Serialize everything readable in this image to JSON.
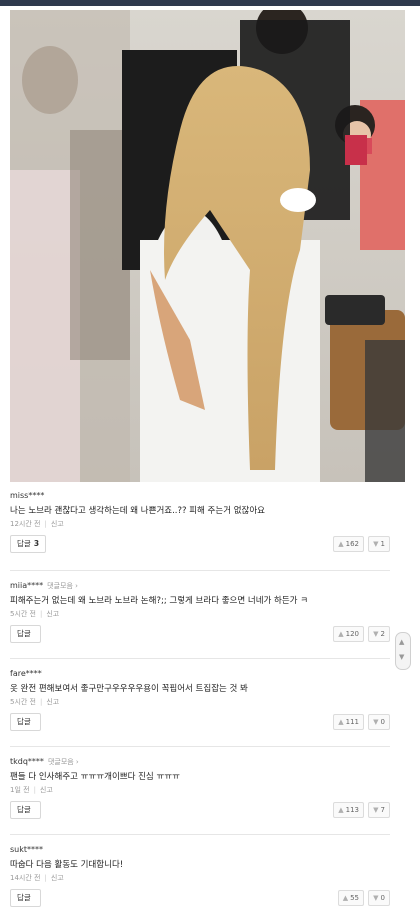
{
  "photo": {
    "alt": "airport crowd photo"
  },
  "comments": [
    {
      "user": "miss****",
      "more": "",
      "text": "나는 노브라 괜찮다고 생각하는데 왜 나쁜거죠..?? 피해 주는거 없잖아요",
      "time": "12시간 전",
      "report": "신고",
      "reply": "답글",
      "reply_count": "3",
      "up": "162",
      "down": "1"
    },
    {
      "user": "miia****",
      "more": "댓글모음 ›",
      "text": "피해주는거 없는데 왜 노브라 노브라 논해?;; 그렇게 브라다 좋으면 너네가 하든가 ㅋ",
      "time": "5시간 전",
      "report": "신고",
      "reply": "답글",
      "reply_count": "",
      "up": "120",
      "down": "2"
    },
    {
      "user": "fare****",
      "more": "",
      "text": "옷 완전 편해보여서 좋구만구우우우우용이 꼭핍어서 트집잡는 것 봐",
      "time": "5시간 전",
      "report": "신고",
      "reply": "답글",
      "reply_count": "",
      "up": "111",
      "down": "0"
    },
    {
      "user": "tkdq****",
      "more": "댓글모음 ›",
      "text": "팬들 다 인사해주고 ㅠㅠㅠ개이쁘다 진심 ㅠㅠㅠ",
      "time": "1일 전",
      "report": "신고",
      "reply": "답글",
      "reply_count": "",
      "up": "113",
      "down": "7"
    },
    {
      "user": "sukt****",
      "more": "",
      "text": "따숩다 다음 활동도 기대합니다!",
      "time": "14시간 전",
      "report": "신고",
      "reply": "답글",
      "reply_count": "",
      "up": "55",
      "down": "0"
    }
  ],
  "icons": {
    "thumbs_up": "thumbs-up-icon",
    "thumbs_down": "thumbs-down-icon",
    "scroll": "scroll-arrows-icon"
  }
}
